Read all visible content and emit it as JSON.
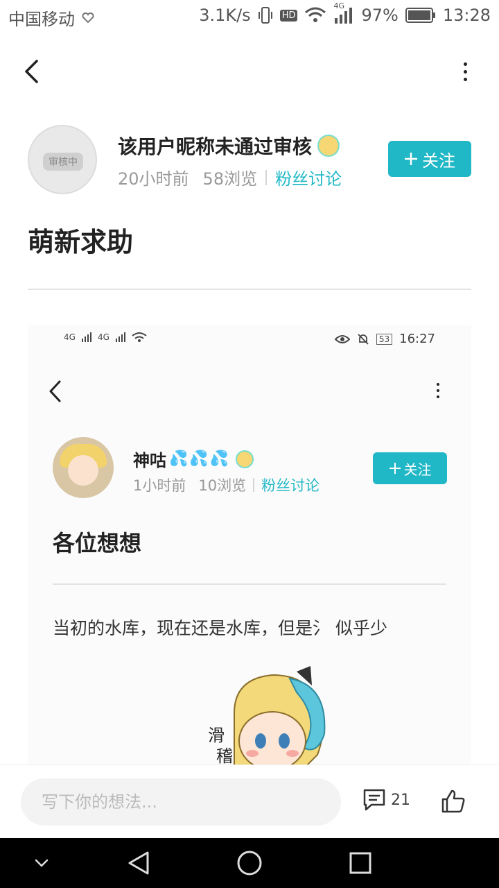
{
  "status_bar": {
    "carrier": "中国移动",
    "net_speed": "3.1K/s",
    "hd": "HD",
    "network": "4G",
    "battery": "97%",
    "time": "13:28"
  },
  "post": {
    "author_name": "该用户昵称未通过审核",
    "avatar_badge": "审核中",
    "time_ago": "20小时前",
    "views": "58浏览",
    "section_link": "粉丝讨论",
    "follow_label": "关注",
    "title": "萌新求助"
  },
  "embedded": {
    "status": {
      "sig1": "4G",
      "sig2": "4G",
      "battery": "53",
      "time": "16:27"
    },
    "author_name": "神咕",
    "drops": "💦💦💦",
    "time_ago": "1小时前",
    "views": "10浏览",
    "section_link": "粉丝讨论",
    "follow_label": "关注",
    "title": "各位想想",
    "body": "当初的水库，现在还是水库，但是氵 似乎少",
    "sticker_text": "滑稽"
  },
  "bottom_bar": {
    "placeholder": "写下你的想法...",
    "comment_count": "21"
  },
  "colors": {
    "accent": "#20b7c6",
    "link": "#23b9c7"
  }
}
